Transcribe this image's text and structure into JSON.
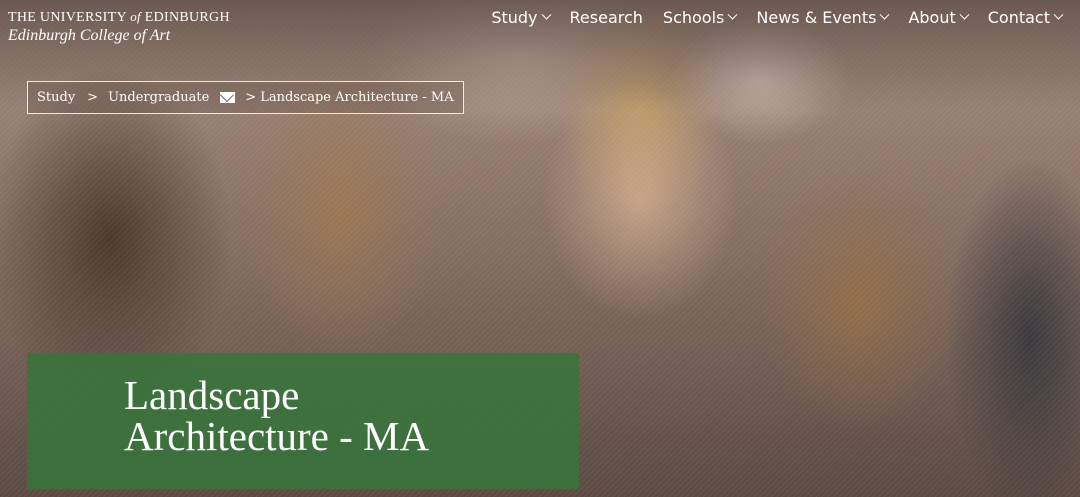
{
  "brand": {
    "university_prefix": "THE UNIVERSITY",
    "university_of": "of",
    "university_suffix": "EDINBURGH",
    "college": "Edinburgh College of Art"
  },
  "nav": {
    "items": [
      {
        "label": "Study",
        "dropdown": true
      },
      {
        "label": "Research",
        "dropdown": false
      },
      {
        "label": "Schools",
        "dropdown": true
      },
      {
        "label": "News & Events",
        "dropdown": true
      },
      {
        "label": "About",
        "dropdown": true
      },
      {
        "label": "Contact",
        "dropdown": true
      }
    ]
  },
  "breadcrumb": {
    "items": [
      "Study",
      "Undergraduate",
      "Landscape Architecture - MA"
    ],
    "separator": ">"
  },
  "hero": {
    "title_line1": "Landscape",
    "title_line2": "Architecture - MA",
    "title_bg_color": "#34763a"
  },
  "icons": {
    "nav_chevron": "chevron-down-icon",
    "breadcrumb_share": "mail-icon"
  }
}
